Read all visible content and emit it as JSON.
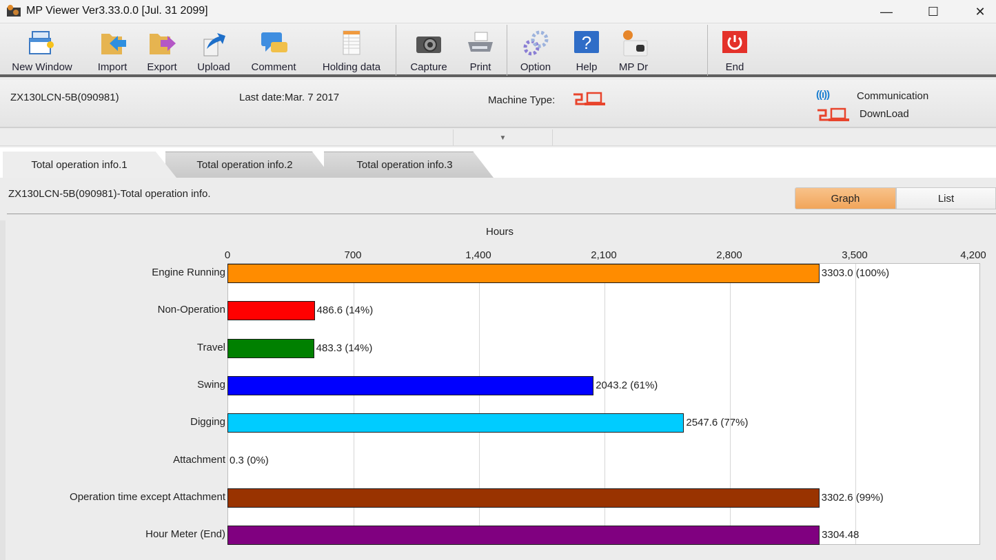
{
  "window": {
    "title": "MP Viewer Ver3.33.0.0 [Jul. 31 2099]",
    "controls": {
      "minimize": "—",
      "maximize": "☐",
      "close": "✕"
    }
  },
  "toolbar": {
    "groups": [
      [
        {
          "id": "new-window",
          "label": "New Window",
          "icon": "new-window-icon"
        },
        {
          "id": "import",
          "label": "Import",
          "icon": "import-folder-icon"
        },
        {
          "id": "export",
          "label": "Export",
          "icon": "export-folder-icon"
        },
        {
          "id": "upload",
          "label": "Upload",
          "icon": "upload-arrow-icon"
        },
        {
          "id": "comment",
          "label": "Comment",
          "icon": "comment-bubbles-icon"
        },
        {
          "id": "holding-data",
          "label": "Holding data",
          "icon": "spreadsheet-icon"
        }
      ],
      [
        {
          "id": "capture",
          "label": "Capture",
          "icon": "camera-icon"
        },
        {
          "id": "print",
          "label": "Print",
          "icon": "printer-icon"
        }
      ],
      [
        {
          "id": "option",
          "label": "Option",
          "icon": "gears-icon"
        },
        {
          "id": "help",
          "label": "Help",
          "icon": "help-question-icon"
        },
        {
          "id": "mp-dr",
          "label": "MP Dr",
          "icon": "mp-dr-device-icon"
        }
      ],
      [
        {
          "id": "end",
          "label": "End",
          "icon": "power-icon"
        }
      ]
    ]
  },
  "info": {
    "model": "ZX130LCN-5B(090981)",
    "last_date": "Last date:Mar. 7 2017",
    "machine_type_label": "Machine Type:",
    "machine_type_icon": "download-laptop-icon",
    "legend": [
      {
        "icon": "communication-antenna-icon",
        "glyph": "((ı))",
        "label": "Communication"
      },
      {
        "icon": "download-laptop-icon",
        "label": "DownLoad"
      }
    ],
    "collapse_glyph": "▼"
  },
  "tabs": [
    {
      "label": "Total operation info.1",
      "active": true
    },
    {
      "label": "Total operation info.2",
      "active": false
    },
    {
      "label": "Total operation info.3",
      "active": false
    }
  ],
  "panel": {
    "title": "ZX130LCN-5B(090981)-Total operation info.",
    "view_toggle": [
      {
        "label": "Graph",
        "selected": true
      },
      {
        "label": "List",
        "selected": false
      }
    ],
    "accent_color": "#f1a55a"
  },
  "chart_data": {
    "type": "bar",
    "orientation": "horizontal",
    "title": "",
    "xlabel": "Hours",
    "ylabel": "",
    "xlim": [
      0,
      4200
    ],
    "xticks": [
      0,
      700,
      1400,
      2100,
      2800,
      3500,
      4200
    ],
    "xtick_labels": [
      "0",
      "700",
      "1,400",
      "2,100",
      "2,800",
      "3,500",
      "4,200"
    ],
    "grid": true,
    "categories": [
      "Engine Running",
      "Non-Operation",
      "Travel",
      "Swing",
      "Digging",
      "Attachment",
      "Operation time except Attachment",
      "Hour Meter (End)"
    ],
    "values": [
      3303.0,
      486.6,
      483.3,
      2043.2,
      2547.6,
      0.3,
      3302.6,
      3304.48
    ],
    "data_labels": [
      "3303.0 (100%)",
      "486.6 (14%)",
      "483.3 (14%)",
      "2043.2 (61%)",
      "2547.6 (77%)",
      "0.3 (0%)",
      "3302.6 (99%)",
      "3304.48"
    ],
    "colors": [
      "#ff8c00",
      "#ff0000",
      "#008000",
      "#0000ff",
      "#00ccff",
      "#ffffff",
      "#993300",
      "#800080"
    ]
  }
}
